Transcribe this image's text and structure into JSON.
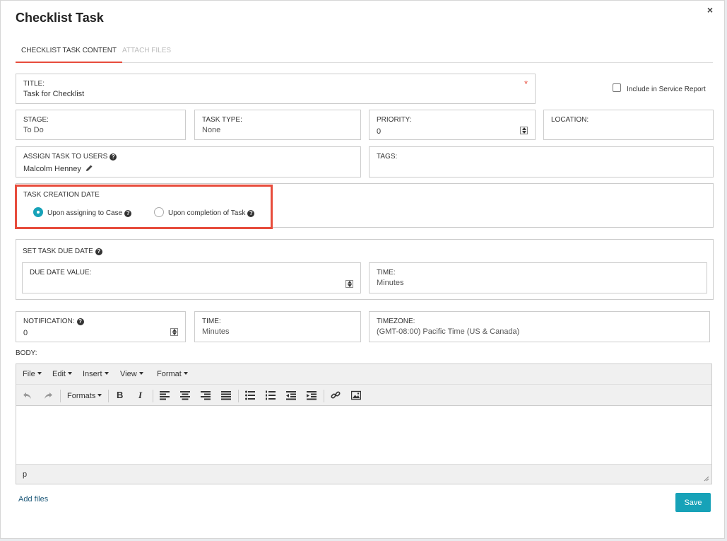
{
  "dialog": {
    "title": "Checklist Task",
    "close": "×"
  },
  "tabs": [
    {
      "label": "CHECKLIST TASK CONTENT",
      "active": true
    },
    {
      "label": "ATTACH FILES",
      "active": false
    }
  ],
  "fields": {
    "title": {
      "label": "TITLE:",
      "value": "Task for Checklist",
      "required": "*"
    },
    "include_report": {
      "label": "Include in Service Report",
      "checked": false
    },
    "stage": {
      "label": "STAGE:",
      "value": "To Do"
    },
    "task_type": {
      "label": "TASK TYPE:",
      "value": "None"
    },
    "priority": {
      "label": "PRIORITY:",
      "value": "0"
    },
    "location": {
      "label": "LOCATION:",
      "value": ""
    },
    "assign_users": {
      "label": "ASSIGN TASK TO USERS",
      "value": "Malcolm Henney"
    },
    "tags": {
      "label": "TAGS:",
      "value": ""
    },
    "creation_date": {
      "label": "TASK CREATION DATE",
      "options": [
        {
          "label": "Upon assigning to Case",
          "selected": true
        },
        {
          "label": "Upon completion of Task",
          "selected": false
        }
      ]
    },
    "due_date": {
      "label": "SET TASK DUE DATE",
      "value_label": "DUE DATE VALUE:",
      "value": "",
      "time_label": "TIME:",
      "time_value": "Minutes"
    },
    "notification": {
      "label": "NOTIFICATION:",
      "value": "0"
    },
    "notif_time": {
      "label": "TIME:",
      "value": "Minutes"
    },
    "timezone": {
      "label": "TIMEZONE:",
      "value": "(GMT-08:00) Pacific Time (US & Canada)"
    },
    "body": {
      "label": "BODY:"
    }
  },
  "editor": {
    "menus": [
      "File",
      "Edit",
      "Insert",
      "View",
      "Format"
    ],
    "formats_label": "Formats",
    "bold": "B",
    "italic": "I",
    "status_path": "p"
  },
  "footer": {
    "add_files": "Add files",
    "save": "Save"
  },
  "colors": {
    "accent": "#17a2b8",
    "highlight": "#e74c3c"
  }
}
